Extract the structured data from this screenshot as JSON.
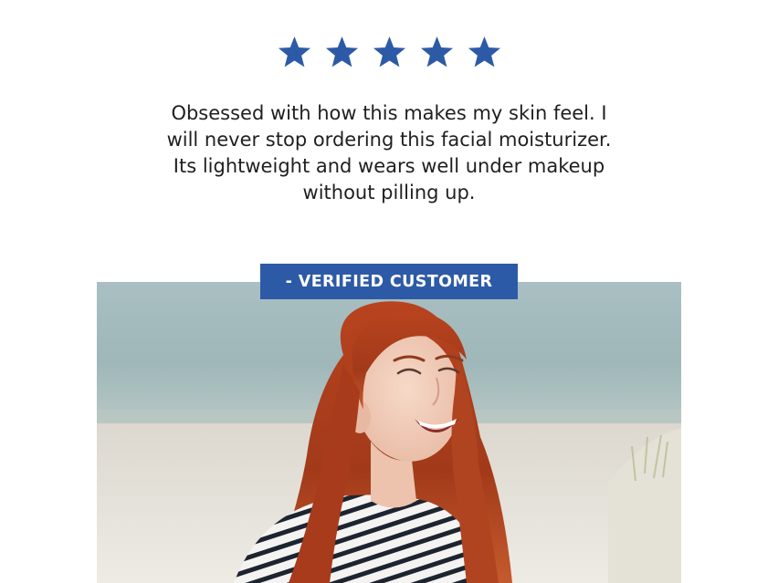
{
  "review": {
    "rating": 5,
    "max_rating": 5,
    "star_color": "#2d5aa6",
    "text": "Obsessed with how this makes my skin feel. I will never stop ordering this facial moisturizer. Its lightweight and wears well under makeup without pilling up.",
    "author_badge": "- VERIFIED CUSTOMER",
    "badge_color": "#2d5aa6"
  },
  "photo": {
    "icon": "smiling-woman-on-beach-photo"
  }
}
